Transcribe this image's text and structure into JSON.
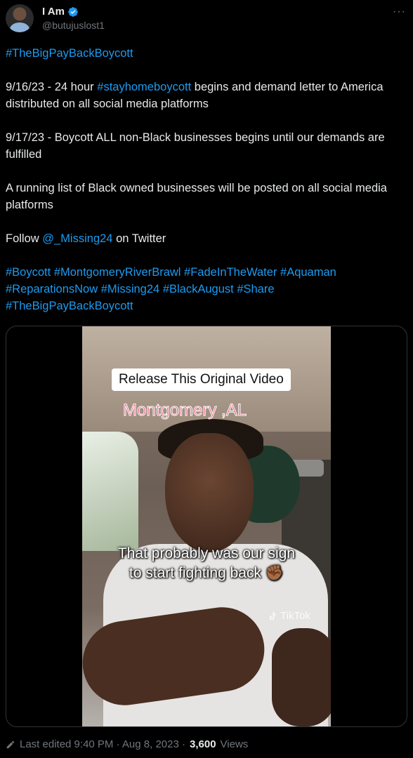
{
  "author": {
    "display_name": "I Am",
    "handle": "@butujuslost1"
  },
  "more_menu": "···",
  "tweet": {
    "line1": "#TheBigPayBackBoycott",
    "p2_pre": "9/16/23 - 24 hour ",
    "p2_link": "#stayhomeboycott",
    "p2_post": " begins and demand letter to America distributed on all social media platforms",
    "p3": "9/17/23 - Boycott ALL non-Black businesses begins until our demands are fulfilled",
    "p4": "A running list of Black owned businesses will be posted on all social media platforms",
    "p5_pre": "Follow ",
    "p5_link": "@_Missing24",
    "p5_post": " on Twitter",
    "hashtags": [
      "#Boycott",
      "#MontgomeryRiverBrawl",
      "#FadeInTheWater",
      "#Aquaman",
      "#ReparationsNow",
      "#Missing24",
      "#BlackAugust",
      "#Share",
      "#TheBigPayBackBoycott"
    ]
  },
  "video": {
    "release_label": "Release This Original Video",
    "location": "Montgomery ,AL",
    "caption_line1": "That probably was our sign",
    "caption_line2": "to start fighting back",
    "emoji": "✊🏾",
    "watermark": "TikTok"
  },
  "footer": {
    "edited": "Last edited 9:40 PM · Aug 8, 2023 · ",
    "views_count": "3,600",
    "views_label": "Views"
  },
  "colors": {
    "link": "#1d9bf0",
    "verified": "#1d9bf0",
    "muted": "#71767b"
  }
}
